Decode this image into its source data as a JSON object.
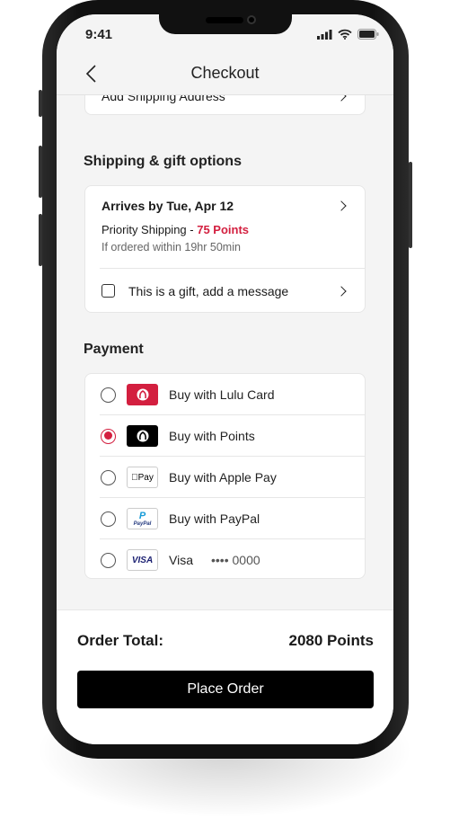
{
  "status_bar": {
    "time": "9:41"
  },
  "header": {
    "title": "Checkout"
  },
  "address": {
    "label": "Add Shipping Address"
  },
  "shipping": {
    "heading": "Shipping & gift options",
    "arrives": "Arrives by Tue, Apr 12",
    "method": "Priority Shipping - ",
    "method_cost": "75 Points",
    "cutoff": "If ordered within 19hr 50min",
    "gift_label": "This is a gift, add a message",
    "gift_checked": false
  },
  "payment": {
    "heading": "Payment",
    "options": [
      {
        "label": "Buy with Lulu Card",
        "icon": "lululemon-logo-red",
        "selected": false
      },
      {
        "label": "Buy with Points",
        "icon": "lululemon-logo-black",
        "selected": true
      },
      {
        "label": "Buy with Apple Pay",
        "icon": "apple-pay-logo",
        "logo_text": "Pay",
        "selected": false
      },
      {
        "label": "Buy with PayPal",
        "icon": "paypal-logo",
        "logo_text": "PayPal",
        "selected": false
      },
      {
        "label": "Visa",
        "icon": "visa-logo",
        "logo_text": "VISA",
        "masked": "•••• 0000",
        "selected": false
      }
    ]
  },
  "order": {
    "total_label": "Order Total:",
    "total_value": "2080 Points",
    "place_order": "Place Order"
  },
  "colors": {
    "accent": "#d31f3f",
    "button": "#000000",
    "background": "#f4f4f4"
  }
}
